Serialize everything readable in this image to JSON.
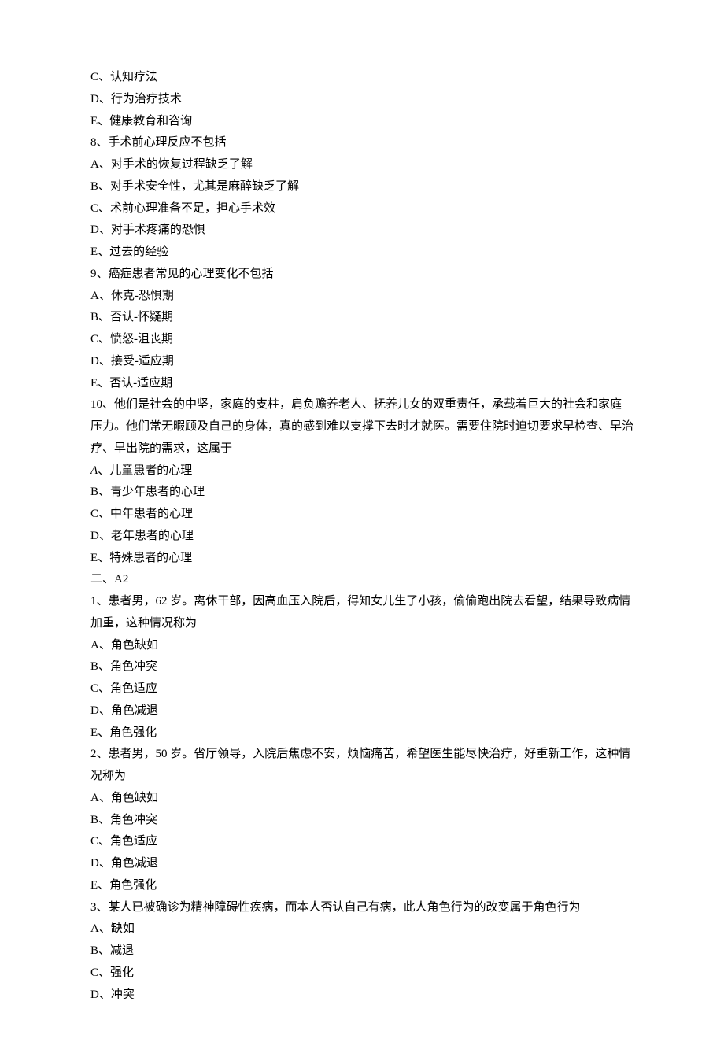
{
  "prevOptions": [
    {
      "label": "C、",
      "text": "认知疗法"
    },
    {
      "label": "D、",
      "text": "行为治疗技术"
    },
    {
      "label": "E、",
      "text": "健康教育和咨询"
    }
  ],
  "sectionA1": [
    {
      "num": "8、",
      "stem": "手术前心理反应不包括",
      "options": [
        {
          "label": "A、",
          "text": "对手术的恢复过程缺乏了解"
        },
        {
          "label": "B、",
          "text": "对手术安全性，尤其是麻醉缺乏了解"
        },
        {
          "label": "C、",
          "text": "术前心理准备不足，担心手术效"
        },
        {
          "label": "D、",
          "text": "对手术疼痛的恐惧"
        },
        {
          "label": "E、",
          "text": "过去的经验"
        }
      ]
    },
    {
      "num": "9、",
      "stem": "癌症患者常见的心理变化不包括",
      "options": [
        {
          "label": "A、",
          "text": "休克-恐惧期"
        },
        {
          "label": "B、",
          "text": "否认-怀疑期"
        },
        {
          "label": "C、",
          "text": "愤怒-沮丧期"
        },
        {
          "label": "D、",
          "text": "接受-适应期"
        },
        {
          "label": "E、",
          "text": "否认-适应期"
        }
      ]
    },
    {
      "num": "10、",
      "stem": "他们是社会的中坚，家庭的支柱，肩负赡养老人、抚养儿女的双重责任，承载着巨大的社会和家庭压力。他们常无暇顾及自己的身体，真的感到难以支撑下去时才就医。需要住院时迫切要求早检查、早治疗、早出院的需求，这属于",
      "optionsSpecial": [
        {
          "labelItalic": "A",
          "labelRest": "、",
          "text": "儿童患者的心理"
        }
      ],
      "options": [
        {
          "label": "B、",
          "text": "青少年患者的心理"
        },
        {
          "label": "C、",
          "text": "中年患者的心理"
        },
        {
          "label": "D、",
          "text": "老年患者的心理"
        },
        {
          "label": "E、",
          "text": "特殊患者的心理"
        }
      ]
    }
  ],
  "sectionA2Header": "二、A2",
  "sectionA2": [
    {
      "num": "1、",
      "stem": "患者男，62 岁。离休干部，因高血压入院后，得知女儿生了小孩，偷偷跑出院去看望，结果导致病情加重，这种情况称为",
      "options": [
        {
          "label": "A、",
          "text": "角色缺如"
        },
        {
          "label": "B、",
          "text": "角色冲突"
        },
        {
          "label": "C、",
          "text": "角色适应"
        },
        {
          "label": "D、",
          "text": "角色减退"
        },
        {
          "label": "E、",
          "text": "角色强化"
        }
      ]
    },
    {
      "num": "2、",
      "stem": "患者男，50 岁。省厅领导，入院后焦虑不安，烦恼痛苦，希望医生能尽快治疗，好重新工作，这种情况称为",
      "options": [
        {
          "label": "A、",
          "text": "角色缺如"
        },
        {
          "label": "B、",
          "text": "角色冲突"
        },
        {
          "label": "C、",
          "text": "角色适应"
        },
        {
          "label": "D、",
          "text": "角色减退"
        },
        {
          "label": "E、",
          "text": "角色强化"
        }
      ]
    },
    {
      "num": "3、",
      "stem": "某人已被确诊为精神障碍性疾病，而本人否认自己有病，此人角色行为的改变属于角色行为",
      "options": [
        {
          "label": "A、",
          "text": "缺如"
        },
        {
          "label": "B、",
          "text": "减退"
        },
        {
          "label": "C、",
          "text": "强化"
        },
        {
          "label": "D、",
          "text": "冲突"
        }
      ]
    }
  ]
}
